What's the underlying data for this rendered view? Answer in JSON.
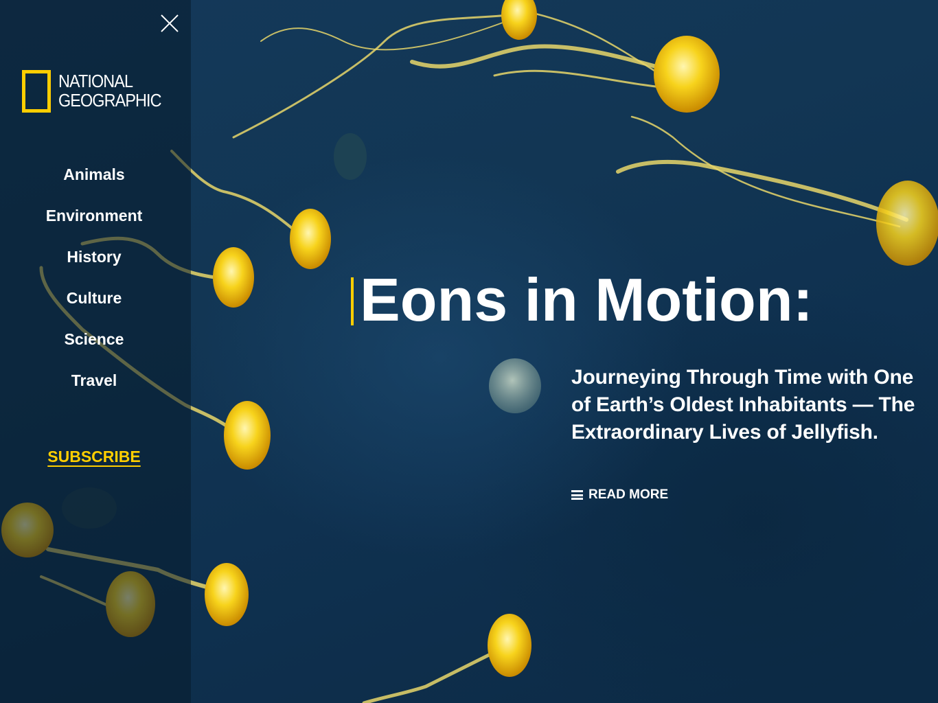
{
  "brand": {
    "name_line1": "NATIONAL",
    "name_line2": "GEOGRAPHIC",
    "accent_color": "#ffce00"
  },
  "sidebar": {
    "close_icon": "close-icon",
    "nav_items": [
      {
        "label": "Animals"
      },
      {
        "label": "Environment"
      },
      {
        "label": "History"
      },
      {
        "label": "Culture"
      },
      {
        "label": "Science"
      },
      {
        "label": "Travel"
      }
    ],
    "subscribe_label": "SUBSCRIBE"
  },
  "hero": {
    "title": "Eons in Motion:",
    "subtitle": "Journeying Through Time with One of Earth’s Oldest Inhabitants — The Extraordinary Lives of Jellyfish.",
    "read_more_label": "READ MORE",
    "read_more_icon": "menu-icon",
    "background_subject": "jellyfish"
  }
}
